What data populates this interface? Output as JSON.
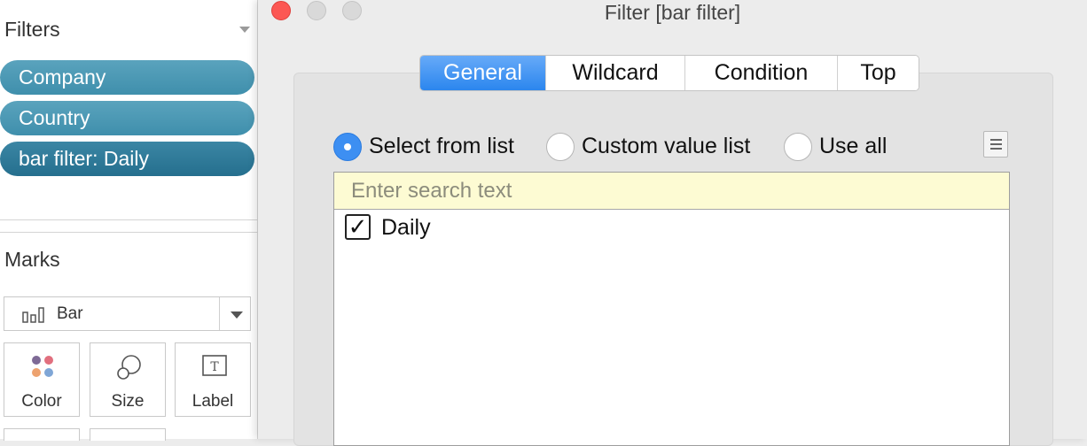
{
  "left_pane": {
    "filters_title": "Filters",
    "filter_pills": [
      {
        "label": "Company"
      },
      {
        "label": "Country"
      },
      {
        "label": "bar filter: Daily"
      }
    ],
    "marks_title": "Marks",
    "mark_type": {
      "selected": "Bar",
      "icon": "bar-chart-icon"
    },
    "mark_buttons": [
      {
        "label": "Color",
        "icon": "color-icon"
      },
      {
        "label": "Size",
        "icon": "size-icon"
      },
      {
        "label": "Label",
        "icon": "label-icon"
      }
    ]
  },
  "dialog": {
    "title": "Filter [bar filter]",
    "window_controls": [
      "close",
      "minimize",
      "zoom"
    ],
    "tabs": [
      {
        "label": "General",
        "active": true
      },
      {
        "label": "Wildcard",
        "active": false
      },
      {
        "label": "Condition",
        "active": false
      },
      {
        "label": "Top",
        "active": false
      }
    ],
    "radio_options": [
      {
        "label": "Select from list",
        "checked": true
      },
      {
        "label": "Custom value list",
        "checked": false
      },
      {
        "label": "Use all",
        "checked": false
      }
    ],
    "search": {
      "placeholder": "Enter search text",
      "value": ""
    },
    "list_items": [
      {
        "label": "Daily",
        "checked": true,
        "check_glyph": "✓"
      }
    ],
    "colors": {
      "active_tab": "#2b86ee",
      "pill": "#4a97b3",
      "pill_selected": "#2e7897",
      "close_button": "#fc5753",
      "search_background": "#fdfbd3"
    }
  }
}
